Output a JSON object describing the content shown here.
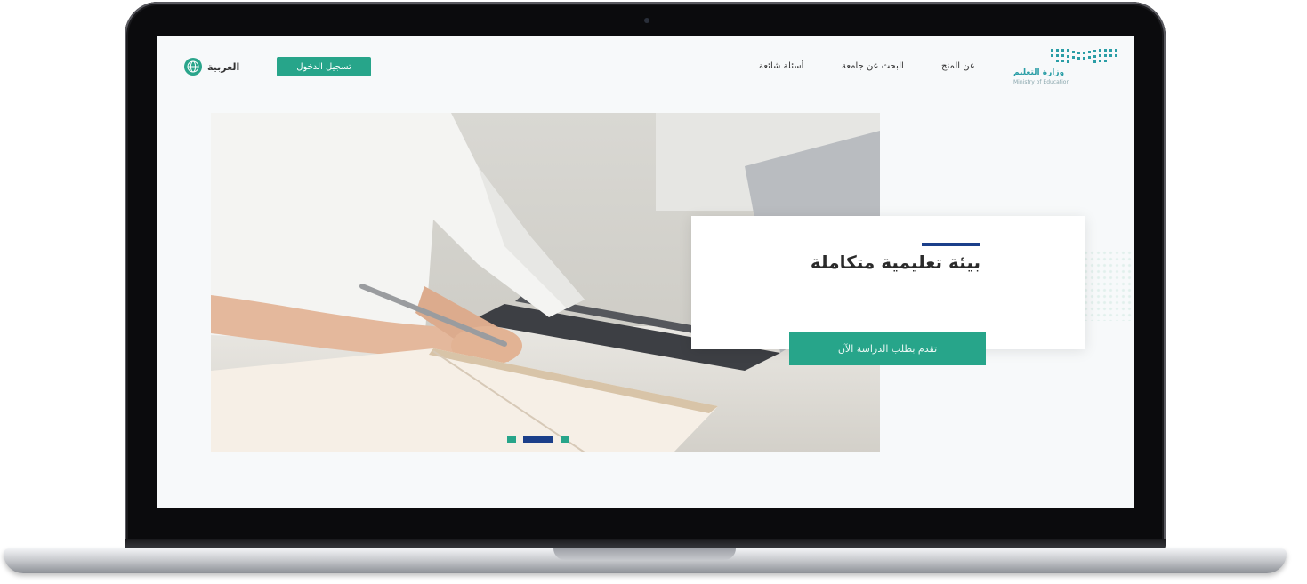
{
  "header": {
    "language_label": "العربية",
    "login_label": "تسجيل الدخول",
    "nav": [
      {
        "label": "عن المنح"
      },
      {
        "label": "البحث عن جامعة"
      },
      {
        "label": "أسئلة شائعة"
      }
    ],
    "logo_text": "وزارة التعليم",
    "logo_sub": "Ministry of Education"
  },
  "hero": {
    "title": "بيئة تعليمية متكاملة",
    "apply_label": "تقدم بطلب الدراسة الآن",
    "slides": 3,
    "active_slide": 2
  },
  "colors": {
    "accent": "#27a58a",
    "brand_navy": "#1b3f8a",
    "logo_teal": "#2a9ea6"
  }
}
